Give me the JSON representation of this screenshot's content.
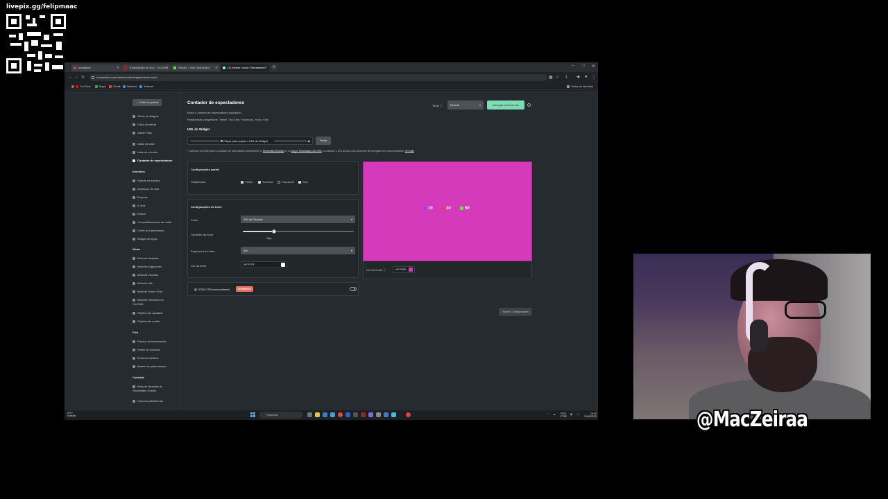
{
  "overlay": {
    "livepix_url": "livepix.gg/felipmaac",
    "handle": "@MacZeiraa"
  },
  "browser": {
    "tabs": [
      {
        "label": "Instagram",
        "favicon_color": "#e1306c"
      },
      {
        "label": "Transmissão ao vivo - YouTube",
        "favicon_color": "#ff0000"
      },
      {
        "label": "Stream - Kick Dashboard",
        "favicon_color": "#53fc18"
      },
      {
        "label": "(1) Viewer Count / Streamlabs",
        "favicon_color": "#80f5d2"
      }
    ],
    "new_tab": "+",
    "window_controls": [
      "–",
      "□",
      "✕"
    ],
    "url": "streamlabs.com/dashboard#/widgets/viewercount",
    "bookmarks": [
      {
        "label": "YouTube",
        "color": "#ff0000"
      },
      {
        "label": "Maps",
        "color": "#34a853"
      },
      {
        "label": "Gmail",
        "color": "#ea4335"
      },
      {
        "label": "Notícias",
        "color": "#4285f4"
      },
      {
        "label": "Traduzir",
        "color": "#4285f4"
      }
    ],
    "bookmarks_right": "Todos os favoritos"
  },
  "sidebar": {
    "back": "← Voltar ao painel",
    "items_top": [
      "Todos os widgets",
      "Caixa de alerta",
      "Game Pass"
    ],
    "items_group": [
      "Caixa de chat",
      "Lista de eventos",
      "Contador de espectadores"
    ],
    "sections": [
      {
        "title": "Interativo",
        "items": [
          "Parede de emotes",
          "Destaque de chat",
          "Enquete",
          "A Jera",
          "Roleta",
          "Compartilhamento de mídia",
          "Chefe da transmissão",
          "Widget de jogos"
        ]
      },
      {
        "title": "Metas",
        "items": [
          "Meta de doações",
          "Meta de seguidores",
          "Meta de inscritos",
          "Meta de bits",
          "Meta de Super Chat",
          "Meta de membros no YouTube",
          "Objetivo de apoiador",
          "Objetivo de sorteio"
        ]
      },
      {
        "title": "Flair",
        "items": [
          "Rótulos de transmissão",
          "Painel de doações",
          "Encerrar créditos",
          "Banner do patrocinador"
        ]
      },
      {
        "title": "Caridade",
        "items": [
          "Meta de doações do Streamlabs Charity",
          "Conecte plataformas"
        ]
      }
    ]
  },
  "main": {
    "title": "Contador de espectadores",
    "subtitle": "Exibir o número de espectadores assistindo.",
    "platforms_supported": "Plataformas compatíveis: Twitch, YouTube, Facebook, Trovo, Kick",
    "theme_label": "Tema",
    "theme_value": "Default",
    "theme_button": "Navegar pelos temas",
    "widget_url_label": "URL do Widget",
    "copy_url": "Clique para copiar o URL do Widget",
    "test_button": "Testar",
    "info": "Adicione os fontes para a contagem de espectadores diretamente no",
    "info_link1": "Streamlabs Desktop",
    "info_mid": "ou no",
    "info_link2": "plug-in Streamlabs para OBS",
    "info_end": ", ou adicione o URL acima como uma fonte de navegador em outros softwares.",
    "info_more": "Ver mais",
    "general": {
      "title": "Configurações gerais",
      "platforms_label": "Plataformas",
      "platforms": [
        {
          "label": "Twitch",
          "checked": true
        },
        {
          "label": "YouTube",
          "checked": true
        },
        {
          "label": "Facebook",
          "checked": false
        },
        {
          "label": "Kick",
          "checked": true
        }
      ]
    },
    "font": {
      "title": "Configurações de fonte",
      "font_label": "Fonte",
      "font_value": "ADLaM Display",
      "size_label": "Tamanho da fonte",
      "size_value": "28px",
      "size_fraction": 0.28,
      "weight_label": "Espessura da fonte",
      "weight_value": "400",
      "color_label": "Cor da fonte",
      "color_value": "#FFFFFF",
      "color_swatch": "#FFFFFF"
    },
    "html_css": {
      "label": "HTML/CSS personalizado",
      "badge": "desabilitado",
      "enabled": false
    },
    "preview": {
      "background": "#d43aba",
      "counts": [
        {
          "platform": "twitch-icon",
          "value": "10",
          "color": "#9146ff"
        },
        {
          "platform": "youtube-icon",
          "value": "20",
          "color": "#ff3b30"
        },
        {
          "platform": "kick-icon",
          "value": "50",
          "color": "#53fc18"
        }
      ]
    },
    "bg_color_label": "Cor de fundo",
    "bg_color_value": "#FF2855",
    "bg_color_swatch": "#d43aba",
    "save_button": "Salvar Configurações"
  },
  "taskbar": {
    "weather_temp": "26°C",
    "weather_desc": "Nublado",
    "search": "Pesquisar",
    "lang": "POR",
    "lang2": "PTB2",
    "time": "16:25",
    "date": "31/05/2025"
  }
}
